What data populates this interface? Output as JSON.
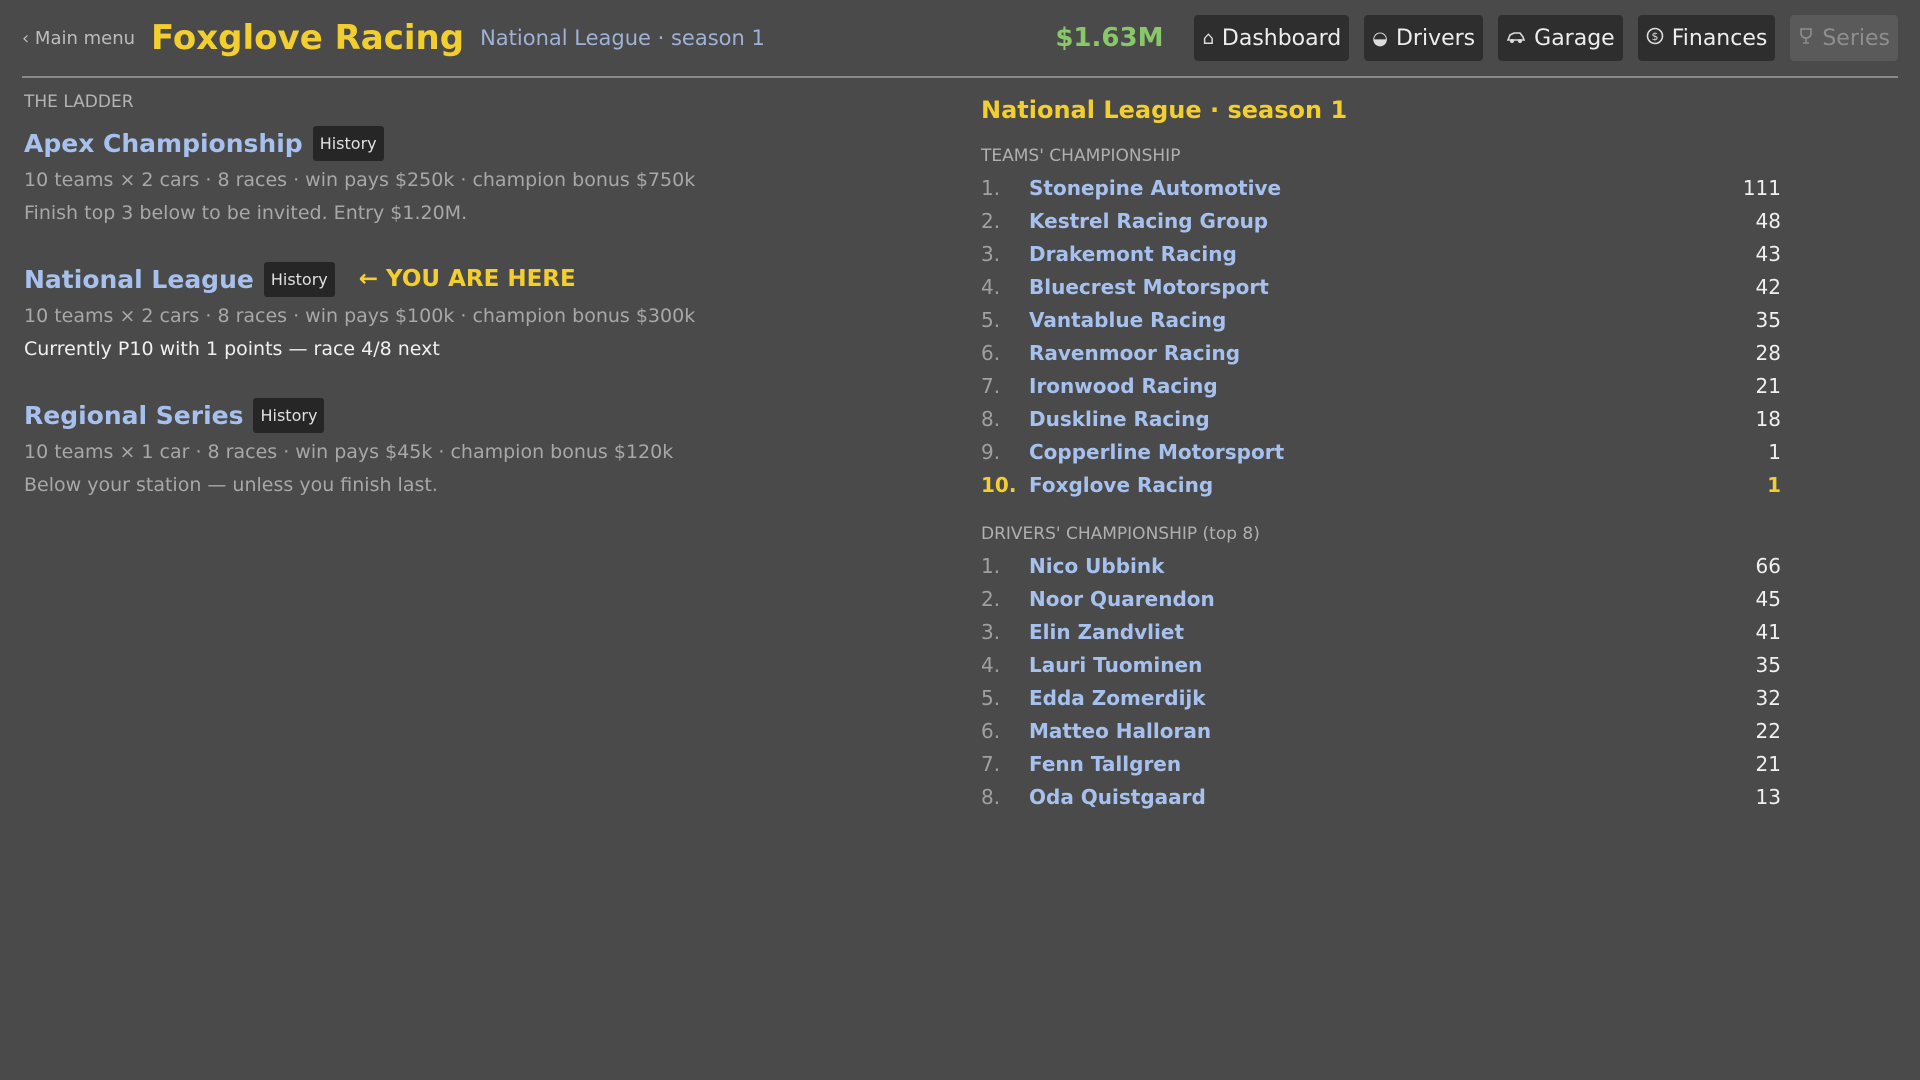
{
  "header": {
    "back_label": "‹ Main menu",
    "team_name": "Foxglove Racing",
    "subtitle": "National League · season 1",
    "cash": "$1.63M",
    "nav": [
      {
        "label": "Dashboard",
        "icon": "home-icon"
      },
      {
        "label": "Drivers",
        "icon": "helmet-icon"
      },
      {
        "label": "Garage",
        "icon": "car-icon"
      },
      {
        "label": "Finances",
        "icon": "dollar-icon"
      },
      {
        "label": "Series",
        "icon": "trophy-icon",
        "disabled": true
      }
    ]
  },
  "ladder": {
    "label": "THE LADDER",
    "history_label": "History",
    "you_are_here": "← YOU ARE HERE",
    "leagues": [
      {
        "title": "Apex Championship",
        "line1": "10 teams × 2 cars · 8 races · win pays $250k · champion bonus $750k",
        "line2": "Finish top 3 below to be invited. Entry $1.20M."
      },
      {
        "title": "National League",
        "line1": "10 teams × 2 cars · 8 races · win pays $100k · champion bonus $300k",
        "line2": "Currently P10 with 1 points — race 4/8 next"
      },
      {
        "title": "Regional Series",
        "line1": "10 teams × 1 car · 8 races · win pays $45k · champion bonus $120k",
        "line2": "Below your station — unless you finish last."
      }
    ]
  },
  "standings": {
    "title": "National League · season 1",
    "teams_label": "TEAMS' CHAMPIONSHIP",
    "teams": [
      {
        "pos": "1.",
        "name": "Stonepine Automotive",
        "pts": "111"
      },
      {
        "pos": "2.",
        "name": "Kestrel Racing Group",
        "pts": "48"
      },
      {
        "pos": "3.",
        "name": "Drakemont Racing",
        "pts": "43"
      },
      {
        "pos": "4.",
        "name": "Bluecrest Motorsport",
        "pts": "42"
      },
      {
        "pos": "5.",
        "name": "Vantablue Racing",
        "pts": "35"
      },
      {
        "pos": "6.",
        "name": "Ravenmoor Racing",
        "pts": "28"
      },
      {
        "pos": "7.",
        "name": "Ironwood Racing",
        "pts": "21"
      },
      {
        "pos": "8.",
        "name": "Duskline Racing",
        "pts": "18"
      },
      {
        "pos": "9.",
        "name": "Copperline Motorsport",
        "pts": "1"
      },
      {
        "pos": "10.",
        "name": "Foxglove Racing",
        "pts": "1"
      }
    ],
    "drivers_label": "DRIVERS' CHAMPIONSHIP (top 8)",
    "drivers": [
      {
        "pos": "1.",
        "name": "Nico Ubbink",
        "pts": "66"
      },
      {
        "pos": "2.",
        "name": "Noor Quarendon",
        "pts": "45"
      },
      {
        "pos": "3.",
        "name": "Elin Zandvliet",
        "pts": "41"
      },
      {
        "pos": "4.",
        "name": "Lauri Tuominen",
        "pts": "35"
      },
      {
        "pos": "5.",
        "name": "Edda Zomerdijk",
        "pts": "32"
      },
      {
        "pos": "6.",
        "name": "Matteo Halloran",
        "pts": "22"
      },
      {
        "pos": "7.",
        "name": "Fenn Tallgren",
        "pts": "21"
      },
      {
        "pos": "8.",
        "name": "Oda Quistgaard",
        "pts": "13"
      }
    ]
  },
  "colors": {
    "background": "#4a4a4a",
    "accent_yellow": "#f2cf2f",
    "link_blue": "#a7c1ee",
    "cash_green": "#8ac769"
  }
}
